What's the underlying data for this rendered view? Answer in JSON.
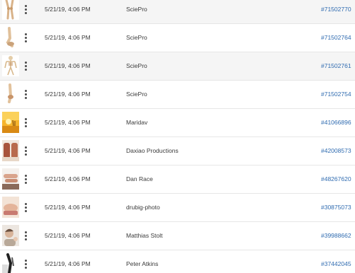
{
  "rows": [
    {
      "thumbnail": "anatomy-legs-bone-icon",
      "date": "5/21/19, 4:06 PM",
      "author": "SciePro",
      "asset_id": "#71502770"
    },
    {
      "thumbnail": "anatomy-foot-bone-icon",
      "date": "5/21/19, 4:06 PM",
      "author": "SciePro",
      "asset_id": "#71502764"
    },
    {
      "thumbnail": "anatomy-skeleton-icon",
      "date": "5/21/19, 4:06 PM",
      "author": "SciePro",
      "asset_id": "#71502761"
    },
    {
      "thumbnail": "anatomy-ankle-bone-icon",
      "date": "5/21/19, 4:06 PM",
      "author": "SciePro",
      "asset_id": "#71502754"
    },
    {
      "thumbnail": "sunset-photo",
      "date": "5/21/19, 4:06 PM",
      "author": "Maridav",
      "asset_id": "#41066896"
    },
    {
      "thumbnail": "feet-spa-photo",
      "date": "5/21/19, 4:06 PM",
      "author": "Daxiao Productions",
      "asset_id": "#42008573"
    },
    {
      "thumbnail": "legs-photo",
      "date": "5/21/19, 4:06 PM",
      "author": "Dan Race",
      "asset_id": "#48267620"
    },
    {
      "thumbnail": "foot-massage-photo",
      "date": "5/21/19, 4:06 PM",
      "author": "drubig-photo",
      "asset_id": "#30875073"
    },
    {
      "thumbnail": "person-portrait-photo",
      "date": "5/21/19, 4:06 PM",
      "author": "Matthias Stolt",
      "asset_id": "#39988662"
    },
    {
      "thumbnail": "xray-photo",
      "date": "5/21/19, 4:06 PM",
      "author": "Peter Atkins",
      "asset_id": "#37442045"
    }
  ]
}
